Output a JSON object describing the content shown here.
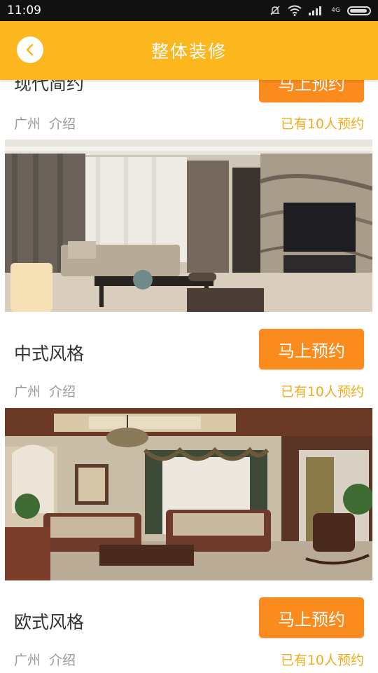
{
  "status_bar": {
    "time": "11:09",
    "network": "4G"
  },
  "header": {
    "title": "整体装修"
  },
  "items": [
    {
      "title": "现代简约",
      "button": "马上预约",
      "city": "广州",
      "intro": "介绍",
      "booked": "已有10人预约"
    },
    {
      "title": "中式风格",
      "button": "马上预约",
      "city": "广州",
      "intro": "介绍",
      "booked": "已有10人预约"
    },
    {
      "title": "欧式风格",
      "button": "马上预约",
      "city": "广州",
      "intro": "介绍",
      "booked": "已有10人预约"
    }
  ],
  "colors": {
    "header": "#fbb71d",
    "button": "#fb8b1c",
    "booked_text": "#f3ab1a",
    "meta_text": "#9a9a9a"
  },
  "icons": [
    "back-chevron-icon",
    "mute-icon",
    "wifi-icon",
    "signal-icon",
    "battery-icon"
  ]
}
